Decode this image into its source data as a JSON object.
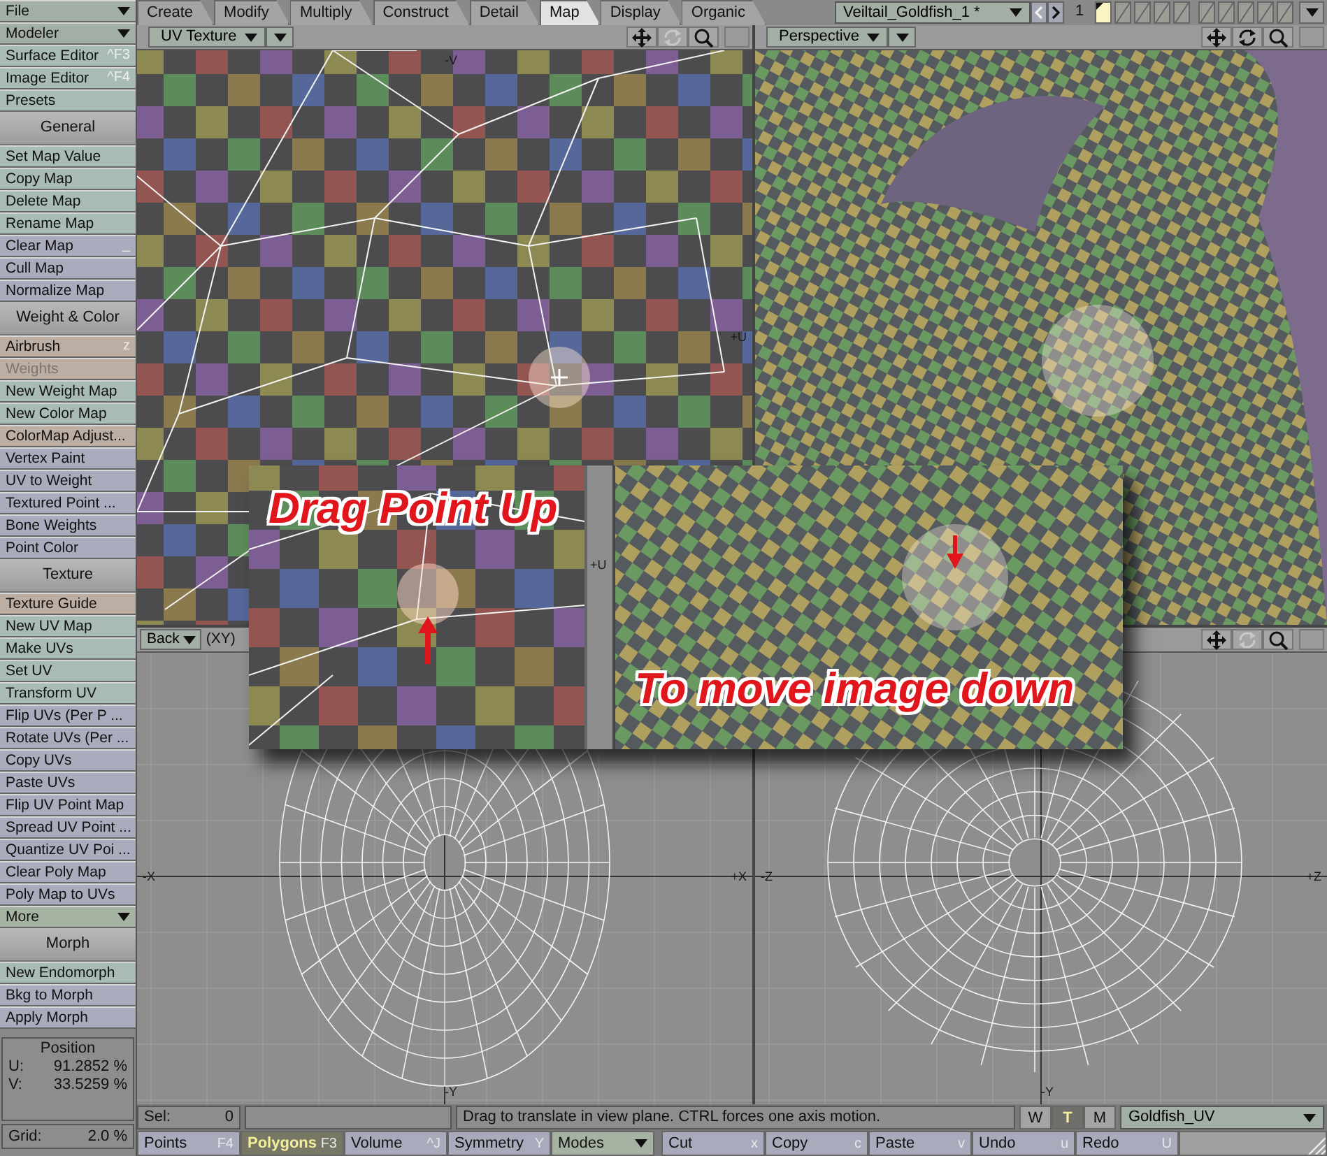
{
  "sidebar": {
    "items": [
      {
        "kind": "dropdown",
        "label": "File",
        "color": "#a3aea5"
      },
      {
        "kind": "dropdown",
        "label": "Modeler",
        "color": "#a3aea5"
      },
      {
        "kind": "button",
        "label": "Surface Editor",
        "shortcut": "^F3",
        "color": "#a9bbb6",
        "disabled": false
      },
      {
        "kind": "button",
        "label": "Image Editor",
        "shortcut": "^F4",
        "color": "#a9bbb6",
        "disabled": false
      },
      {
        "kind": "button",
        "label": "Presets",
        "color": "#a9bbb6",
        "disabled": false
      },
      {
        "kind": "header",
        "label": "General"
      },
      {
        "kind": "button",
        "label": "Set Map Value",
        "color": "#a9bbb6",
        "disabled": false
      },
      {
        "kind": "button",
        "label": "Copy Map",
        "color": "#a9bbb6",
        "disabled": false
      },
      {
        "kind": "button",
        "label": "Delete Map",
        "color": "#a9bbb6",
        "disabled": false
      },
      {
        "kind": "button",
        "label": "Rename Map",
        "color": "#a9bbb6",
        "disabled": false
      },
      {
        "kind": "button",
        "label": "Clear Map",
        "shortcut": "_",
        "color": "#aaacbd",
        "disabled": false
      },
      {
        "kind": "button",
        "label": "Cull Map",
        "color": "#aaacbd",
        "disabled": false
      },
      {
        "kind": "button",
        "label": "Normalize Map",
        "color": "#aaacbd",
        "disabled": false
      },
      {
        "kind": "header",
        "label": "Weight & Color"
      },
      {
        "kind": "button",
        "label": "Airbrush",
        "shortcut": "z",
        "color": "#bdaea3",
        "disabled": false
      },
      {
        "kind": "button",
        "label": "Weights",
        "color": "#bdaea3",
        "disabled": true
      },
      {
        "kind": "button",
        "label": "New Weight Map",
        "color": "#a9bbb6",
        "disabled": false
      },
      {
        "kind": "button",
        "label": "New Color Map",
        "color": "#a9bbb6",
        "disabled": false
      },
      {
        "kind": "button",
        "label": "ColorMap Adjust...",
        "color": "#bdaea3",
        "disabled": false
      },
      {
        "kind": "button",
        "label": "Vertex Paint",
        "color": "#aaacbd",
        "disabled": false
      },
      {
        "kind": "button",
        "label": "UV to Weight",
        "color": "#aaacbd",
        "disabled": false
      },
      {
        "kind": "button",
        "label": "Textured Point ...",
        "color": "#aaacbd",
        "disabled": false
      },
      {
        "kind": "button",
        "label": "Bone Weights",
        "color": "#aaacbd",
        "disabled": false
      },
      {
        "kind": "button",
        "label": "Point Color",
        "color": "#aaacbd",
        "disabled": false
      },
      {
        "kind": "header",
        "label": "Texture"
      },
      {
        "kind": "button",
        "label": "Texture Guide",
        "color": "#bdaea3",
        "disabled": false
      },
      {
        "kind": "button",
        "label": "New UV Map",
        "color": "#a9bbb6",
        "disabled": false
      },
      {
        "kind": "button",
        "label": "Make UVs",
        "color": "#a9bbb6",
        "disabled": false
      },
      {
        "kind": "button",
        "label": "Set UV",
        "color": "#a9bbb6",
        "disabled": false
      },
      {
        "kind": "button",
        "label": "Transform UV",
        "color": "#a9bbb6",
        "disabled": false
      },
      {
        "kind": "button",
        "label": "Flip UVs (Per P ...",
        "color": "#aaacbd",
        "disabled": false
      },
      {
        "kind": "button",
        "label": "Rotate UVs (Per ...",
        "color": "#aaacbd",
        "disabled": false
      },
      {
        "kind": "button",
        "label": "Copy UVs",
        "color": "#aaacbd",
        "disabled": false
      },
      {
        "kind": "button",
        "label": "Paste UVs",
        "color": "#aaacbd",
        "disabled": false
      },
      {
        "kind": "button",
        "label": "Flip UV Point Map",
        "color": "#aaacbd",
        "disabled": false
      },
      {
        "kind": "button",
        "label": "Spread UV Point ...",
        "color": "#aaacbd",
        "disabled": false
      },
      {
        "kind": "button",
        "label": "Quantize UV Poi ...",
        "color": "#aaacbd",
        "disabled": false
      },
      {
        "kind": "button",
        "label": "Clear Poly Map",
        "color": "#aaacbd",
        "disabled": false
      },
      {
        "kind": "button",
        "label": "Poly Map to UVs",
        "color": "#aaacbd",
        "disabled": false
      },
      {
        "kind": "dropdown",
        "label": "More",
        "color": "#a6b3a3"
      },
      {
        "kind": "header",
        "label": "Morph"
      },
      {
        "kind": "button",
        "label": "New Endomorph",
        "color": "#a9bbb6",
        "disabled": false
      },
      {
        "kind": "button",
        "label": "Bkg to Morph",
        "color": "#aaacbd",
        "disabled": false
      },
      {
        "kind": "button",
        "label": "Apply Morph",
        "color": "#aaacbd",
        "disabled": false
      }
    ]
  },
  "position": {
    "title": "Position",
    "rows": [
      {
        "label": "U:",
        "value": "91.2852 %"
      },
      {
        "label": "V:",
        "value": "33.5259 %"
      }
    ]
  },
  "grid": {
    "label": "Grid:",
    "value": "2.0 %"
  },
  "tabs": [
    {
      "label": "Create",
      "selected": false
    },
    {
      "label": "Modify",
      "selected": false
    },
    {
      "label": "Multiply",
      "selected": false
    },
    {
      "label": "Construct",
      "selected": false
    },
    {
      "label": "Detail",
      "selected": false
    },
    {
      "label": "Map",
      "selected": true
    },
    {
      "label": "Display",
      "selected": false
    },
    {
      "label": "Organic",
      "selected": false
    }
  ],
  "object_selector": {
    "label": "Veiltail_Goldfish_1 *"
  },
  "layer_number": "1",
  "layers": [
    {
      "selected": true
    },
    {
      "selected": false
    },
    {
      "selected": false
    },
    {
      "selected": false
    },
    {
      "selected": false
    },
    {
      "selected": false
    },
    {
      "selected": false
    },
    {
      "selected": false
    },
    {
      "selected": false
    },
    {
      "selected": false
    }
  ],
  "viewports": [
    {
      "kind": "uv",
      "title": "UV Texture",
      "rotate_enabled": false,
      "axes": {
        "top": "-V",
        "right": "+U"
      }
    },
    {
      "kind": "perspective",
      "title": "Perspective",
      "rotate_enabled": true
    },
    {
      "kind": "front",
      "title": "Back",
      "projection": "(XY)",
      "axes": {
        "left": "-X",
        "right": "+X",
        "bottom": "-Y"
      }
    },
    {
      "kind": "side",
      "rotate_enabled": false,
      "axes": {
        "left": "-Z",
        "right": "+Z",
        "bottom": "-Y"
      }
    }
  ],
  "callout": {
    "top_text": "Drag Point Up",
    "bottom_text": "To move image down",
    "strip_label": "+U"
  },
  "status": {
    "sel_label": "Sel:",
    "sel_value": "0",
    "message": "Drag to translate in view plane. CTRL forces one axis motion.",
    "modes": [
      {
        "label": "W",
        "selected": false
      },
      {
        "label": "T",
        "selected": true
      },
      {
        "label": "M",
        "selected": false
      }
    ],
    "map": "Goldfish_UV"
  },
  "tools": [
    {
      "kind": "button",
      "label": "Points",
      "shortcut": "F4",
      "selected": false
    },
    {
      "kind": "button",
      "label": "Polygons",
      "shortcut": "F3",
      "selected": true
    },
    {
      "kind": "button",
      "label": "Volume",
      "shortcut": "^J",
      "selected": false
    },
    {
      "kind": "button",
      "label": "Symmetry",
      "shortcut": "Y",
      "selected": false
    },
    {
      "kind": "dropdown",
      "label": "Modes"
    },
    {
      "kind": "button",
      "label": "Cut",
      "shortcut": "x",
      "selected": false
    },
    {
      "kind": "button",
      "label": "Copy",
      "shortcut": "c",
      "selected": false
    },
    {
      "kind": "button",
      "label": "Paste",
      "shortcut": "v",
      "selected": false
    },
    {
      "kind": "button",
      "label": "Undo",
      "shortcut": "u",
      "selected": false
    },
    {
      "kind": "button",
      "label": "Redo",
      "shortcut": "U",
      "selected": false
    }
  ]
}
